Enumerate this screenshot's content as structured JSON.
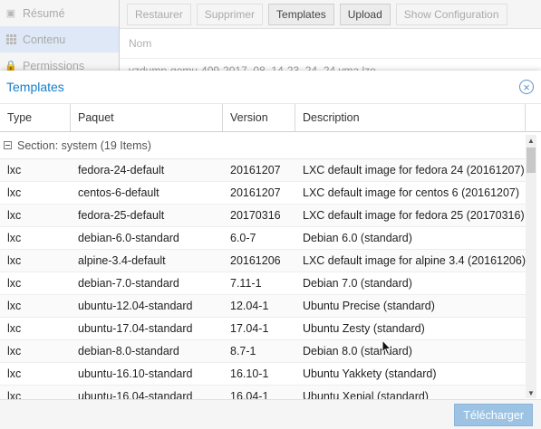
{
  "nav": {
    "items": [
      {
        "label": "Résumé",
        "icon": "book-icon"
      },
      {
        "label": "Contenu",
        "icon": "grid-icon"
      },
      {
        "label": "Permissions",
        "icon": "lock-icon"
      }
    ]
  },
  "toolbar": {
    "restore": "Restaurer",
    "delete": "Supprimer",
    "templates": "Templates",
    "upload": "Upload",
    "show_config": "Show Configuration"
  },
  "content": {
    "column_name": "Nom",
    "row1": "vzdump-qemu-409-2017_08_14-23_24_24.vma.lzo"
  },
  "modal": {
    "title": "Templates",
    "columns": {
      "type": "Type",
      "package": "Paquet",
      "version": "Version",
      "description": "Description"
    },
    "section": "Section: system (19 Items)",
    "rows": [
      {
        "type": "lxc",
        "package": "fedora-24-default",
        "version": "20161207",
        "description": "LXC default image for fedora 24 (20161207)"
      },
      {
        "type": "lxc",
        "package": "centos-6-default",
        "version": "20161207",
        "description": "LXC default image for centos 6 (20161207)"
      },
      {
        "type": "lxc",
        "package": "fedora-25-default",
        "version": "20170316",
        "description": "LXC default image for fedora 25 (20170316)"
      },
      {
        "type": "lxc",
        "package": "debian-6.0-standard",
        "version": "6.0-7",
        "description": "Debian 6.0 (standard)"
      },
      {
        "type": "lxc",
        "package": "alpine-3.4-default",
        "version": "20161206",
        "description": "LXC default image for alpine 3.4 (20161206)"
      },
      {
        "type": "lxc",
        "package": "debian-7.0-standard",
        "version": "7.11-1",
        "description": "Debian 7.0 (standard)"
      },
      {
        "type": "lxc",
        "package": "ubuntu-12.04-standard",
        "version": "12.04-1",
        "description": "Ubuntu Precise (standard)"
      },
      {
        "type": "lxc",
        "package": "ubuntu-17.04-standard",
        "version": "17.04-1",
        "description": "Ubuntu Zesty (standard)"
      },
      {
        "type": "lxc",
        "package": "debian-8.0-standard",
        "version": "8.7-1",
        "description": "Debian 8.0 (standard)"
      },
      {
        "type": "lxc",
        "package": "ubuntu-16.10-standard",
        "version": "16.10-1",
        "description": "Ubuntu Yakkety (standard)"
      },
      {
        "type": "lxc",
        "package": "ubuntu-16.04-standard",
        "version": "16.04-1",
        "description": "Ubuntu Xenial (standard)"
      }
    ],
    "download": "Télécharger"
  },
  "colors": {
    "accent": "#157fcc",
    "download_bg": "#9cc3e3"
  }
}
